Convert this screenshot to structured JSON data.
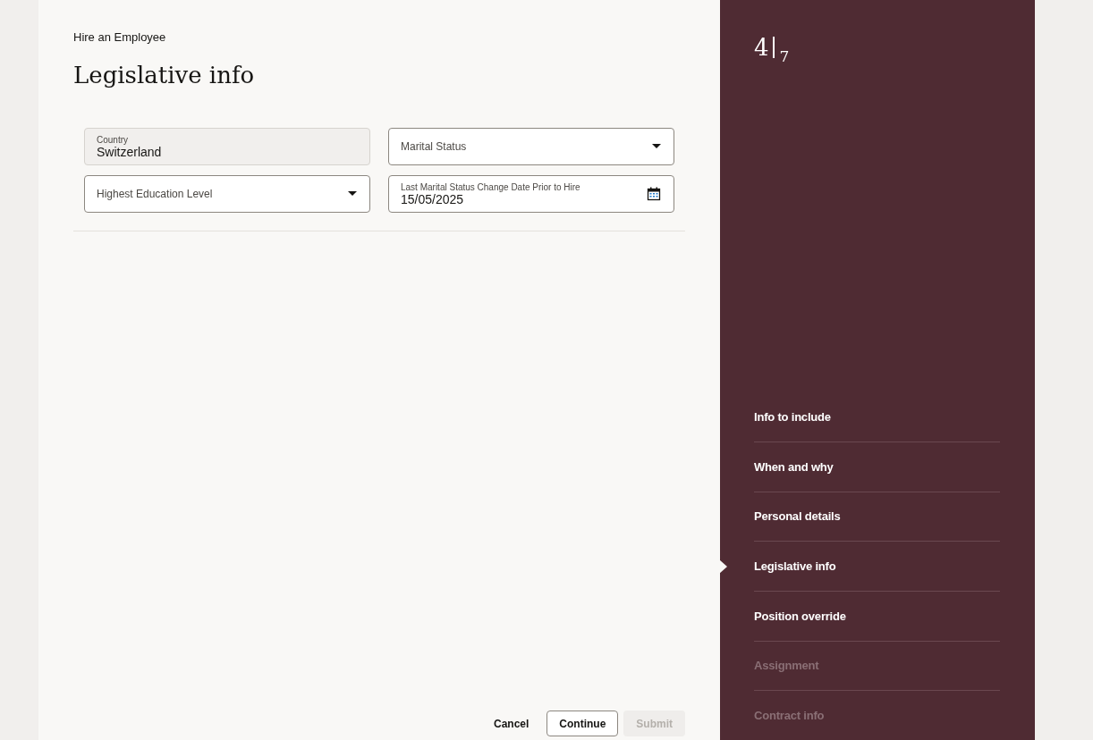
{
  "header": {
    "task": "Hire an Employee",
    "title": "Legislative info"
  },
  "fields": [
    {
      "kind": "readonly",
      "label": "Country",
      "value": "Switzerland"
    },
    {
      "kind": "select",
      "label": "Marital Status"
    },
    {
      "kind": "select",
      "label": "Highest Education Level"
    },
    {
      "kind": "date",
      "label": "Last Marital Status Change Date Prior to Hire",
      "value": "15/05/2025"
    }
  ],
  "buttons": [
    {
      "label": "Cancel",
      "kind": "text",
      "disabled": false
    },
    {
      "label": "Continue",
      "kind": "outline",
      "disabled": false
    },
    {
      "label": "Submit",
      "kind": "solid",
      "disabled": true
    }
  ],
  "progress": {
    "current": "4",
    "total": "7"
  },
  "steps": [
    {
      "label": "Info to include",
      "selected": false,
      "disabled": false
    },
    {
      "label": "When and why",
      "selected": false,
      "disabled": false
    },
    {
      "label": "Personal details",
      "selected": false,
      "disabled": false
    },
    {
      "label": "Legislative info",
      "selected": true,
      "disabled": false
    },
    {
      "label": "Position override",
      "selected": false,
      "disabled": false
    },
    {
      "label": "Assignment",
      "selected": false,
      "disabled": true
    },
    {
      "label": "Contract info",
      "selected": false,
      "disabled": true
    }
  ]
}
